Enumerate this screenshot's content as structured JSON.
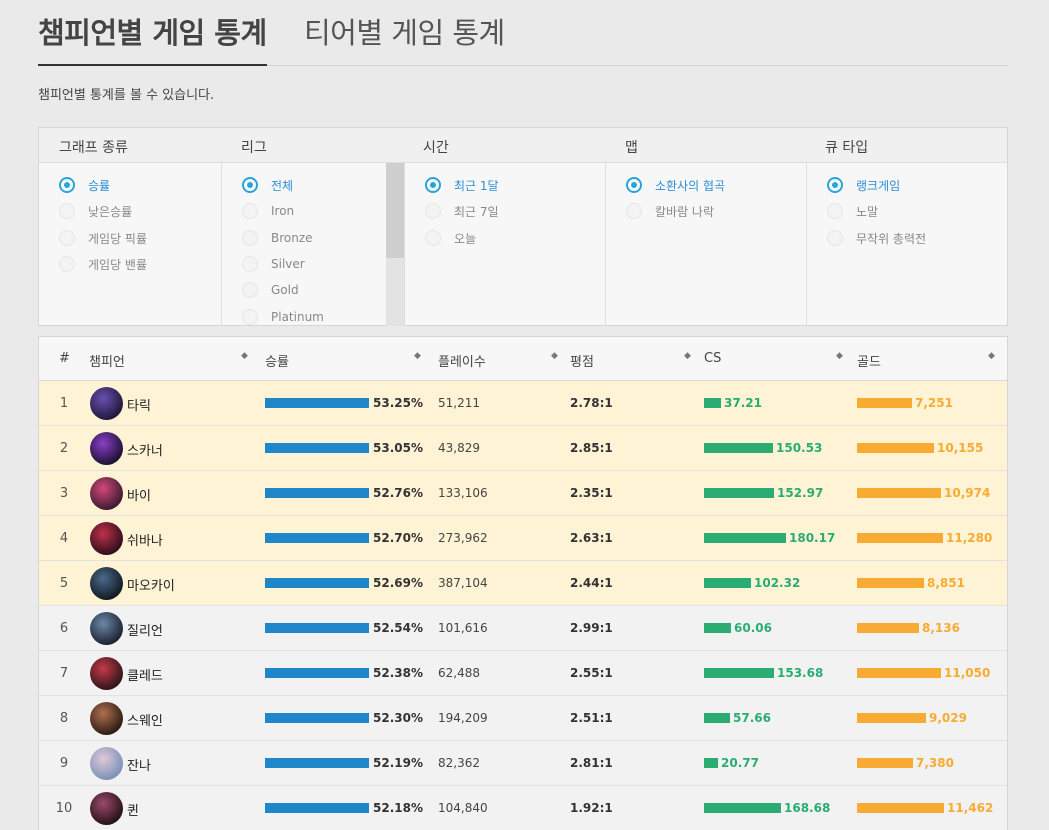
{
  "tabs": {
    "active": "챔피언별 게임 통계",
    "inactive": "티어별 게임 통계"
  },
  "description": "챔피언별 통계를 볼 수 있습니다.",
  "filters": {
    "graph_type": {
      "title": "그래프 종류",
      "options": [
        "승률",
        "낮은승률",
        "게임당 픽률",
        "게임당 밴률"
      ],
      "selected": 0
    },
    "league": {
      "title": "리그",
      "options": [
        "전체",
        "Iron",
        "Bronze",
        "Silver",
        "Gold",
        "Platinum"
      ],
      "selected": 0
    },
    "time": {
      "title": "시간",
      "options": [
        "최근 1달",
        "최근 7일",
        "오늘"
      ],
      "selected": 0
    },
    "map": {
      "title": "맵",
      "options": [
        "소환사의 협곡",
        "칼바람 나락"
      ],
      "selected": 0
    },
    "queue": {
      "title": "큐 타입",
      "options": [
        "랭크게임",
        "노말",
        "무작위 총력전"
      ],
      "selected": 0
    }
  },
  "table": {
    "headers": {
      "rank": "#",
      "champion": "챔피언",
      "winrate": "승률",
      "plays": "플레이수",
      "kda": "평점",
      "cs": "CS",
      "gold": "골드"
    },
    "sort_icon": "◆",
    "rows": [
      {
        "rank": "1",
        "name": "타릭",
        "winrate": "53.25%",
        "winrate_pct": 53.25,
        "plays": "51,211",
        "kda": "2.78:1",
        "cs": "37.21",
        "cs_num": 37.21,
        "gold": "7,251",
        "gold_num": 7251,
        "highlight": true,
        "avatar_colors": [
          "#6a4fb0",
          "#1e1838"
        ]
      },
      {
        "rank": "2",
        "name": "스카너",
        "winrate": "53.05%",
        "winrate_pct": 53.05,
        "plays": "43,829",
        "kda": "2.85:1",
        "cs": "150.53",
        "cs_num": 150.53,
        "gold": "10,155",
        "gold_num": 10155,
        "highlight": true,
        "avatar_colors": [
          "#8a3fc7",
          "#1a1030"
        ]
      },
      {
        "rank": "3",
        "name": "바이",
        "winrate": "52.76%",
        "winrate_pct": 52.76,
        "plays": "133,106",
        "kda": "2.35:1",
        "cs": "152.97",
        "cs_num": 152.97,
        "gold": "10,974",
        "gold_num": 10974,
        "highlight": true,
        "avatar_colors": [
          "#d2487a",
          "#3a1a2e"
        ]
      },
      {
        "rank": "4",
        "name": "쉬바나",
        "winrate": "52.70%",
        "winrate_pct": 52.7,
        "plays": "273,962",
        "kda": "2.63:1",
        "cs": "180.17",
        "cs_num": 180.17,
        "gold": "11,280",
        "gold_num": 11280,
        "highlight": true,
        "avatar_colors": [
          "#c0304a",
          "#2a0e1c"
        ]
      },
      {
        "rank": "5",
        "name": "마오카이",
        "winrate": "52.69%",
        "winrate_pct": 52.69,
        "plays": "387,104",
        "kda": "2.44:1",
        "cs": "102.32",
        "cs_num": 102.32,
        "gold": "8,851",
        "gold_num": 8851,
        "highlight": true,
        "avatar_colors": [
          "#4a6a8a",
          "#111820"
        ]
      },
      {
        "rank": "6",
        "name": "질리언",
        "winrate": "52.54%",
        "winrate_pct": 52.54,
        "plays": "101,616",
        "kda": "2.99:1",
        "cs": "60.06",
        "cs_num": 60.06,
        "gold": "8,136",
        "gold_num": 8136,
        "highlight": false,
        "avatar_colors": [
          "#6a88a8",
          "#1c2030"
        ]
      },
      {
        "rank": "7",
        "name": "클레드",
        "winrate": "52.38%",
        "winrate_pct": 52.38,
        "plays": "62,488",
        "kda": "2.55:1",
        "cs": "153.68",
        "cs_num": 153.68,
        "gold": "11,050",
        "gold_num": 11050,
        "highlight": false,
        "avatar_colors": [
          "#c43a4a",
          "#2c1418"
        ]
      },
      {
        "rank": "8",
        "name": "스웨인",
        "winrate": "52.30%",
        "winrate_pct": 52.3,
        "plays": "194,209",
        "kda": "2.51:1",
        "cs": "57.66",
        "cs_num": 57.66,
        "gold": "9,029",
        "gold_num": 9029,
        "highlight": false,
        "avatar_colors": [
          "#b07050",
          "#2a1a14"
        ]
      },
      {
        "rank": "9",
        "name": "잔나",
        "winrate": "52.19%",
        "winrate_pct": 52.19,
        "plays": "82,362",
        "kda": "2.81:1",
        "cs": "20.77",
        "cs_num": 20.77,
        "gold": "7,380",
        "gold_num": 7380,
        "highlight": false,
        "avatar_colors": [
          "#e0c8d8",
          "#7a90b8"
        ]
      },
      {
        "rank": "10",
        "name": "퀸",
        "winrate": "52.18%",
        "winrate_pct": 52.18,
        "plays": "104,840",
        "kda": "1.92:1",
        "cs": "168.68",
        "cs_num": 168.68,
        "gold": "11,462",
        "gold_num": 11462,
        "highlight": false,
        "avatar_colors": [
          "#9a4a6a",
          "#241018"
        ]
      }
    ]
  }
}
